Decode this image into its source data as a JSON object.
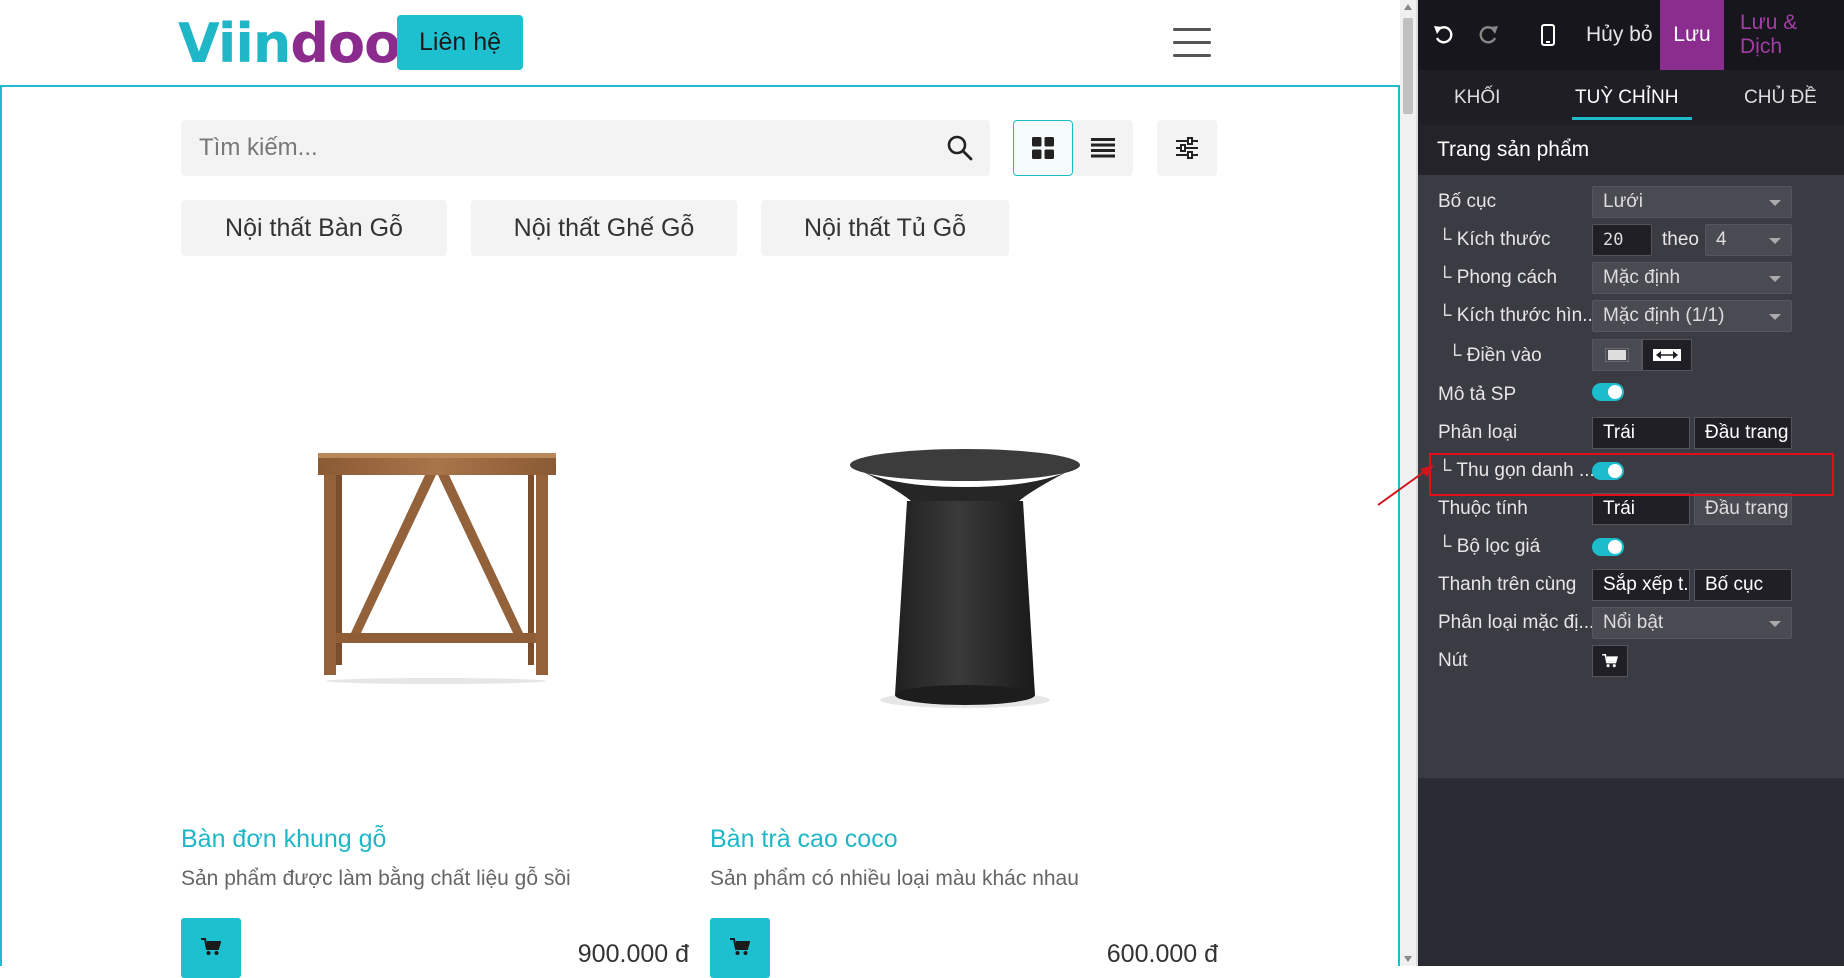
{
  "site": {
    "logo_part1": "Viin",
    "logo_part2": "doo",
    "contact_label": "Liên hệ",
    "search_placeholder": "Tìm kiếm...",
    "categories": [
      "Nội thất Bàn Gỗ",
      "Nội thất Ghế Gỗ",
      "Nội thất Tủ Gỗ"
    ],
    "products": [
      {
        "title": "Bàn đơn khung gỗ",
        "desc": "Sản phẩm được làm bằng chất liệu gỗ sồi",
        "price": "900.000 đ"
      },
      {
        "title": "Bàn trà cao coco",
        "desc": "Sản phẩm có nhiều loại màu khác nhau",
        "price": "600.000 đ"
      }
    ]
  },
  "panel": {
    "toolbar": {
      "cancel": "Hủy bỏ",
      "save": "Lưu",
      "save_translate": "Lưu & Dịch"
    },
    "tabs": [
      "KHỐI",
      "TUỲ CHỈNH",
      "CHỦ ĐỀ"
    ],
    "active_tab": "TUỲ CHỈNH",
    "section_title": "Trang sản phẩm",
    "rows": {
      "layout_label": "Bố cục",
      "layout_value": "Lưới",
      "size_label": "└ Kích thước",
      "size_value": "20",
      "size_by": "theo",
      "size_cols": "4",
      "style_label": "└ Phong cách",
      "style_value": "Mặc định",
      "imgsize_label": "└ Kích thước hìn...",
      "imgsize_value": "Mặc định (1/1)",
      "fill_label": "└ Điền vào",
      "desc_label": "Mô tả SP",
      "categ_label": "Phân loại",
      "categ_left": "Trái",
      "categ_top": "Đầu trang",
      "collapse_label": "└ Thu gọn danh ...",
      "attr_label": "Thuộc tính",
      "attr_left": "Trái",
      "attr_top": "Đầu trang",
      "price_filter_label": "└ Bộ lọc giá",
      "topbar_label": "Thanh trên cùng",
      "topbar_sort": "Sắp xếp t...",
      "topbar_layout": "Bố cục",
      "default_sort_label": "Phân loại mặc đị...",
      "default_sort_value": "Nổi bật",
      "button_label": "Nút"
    }
  },
  "colors": {
    "brand_teal": "#1cc0cf",
    "brand_purple": "#8a2d8e",
    "highlight_red": "#e0101a"
  }
}
